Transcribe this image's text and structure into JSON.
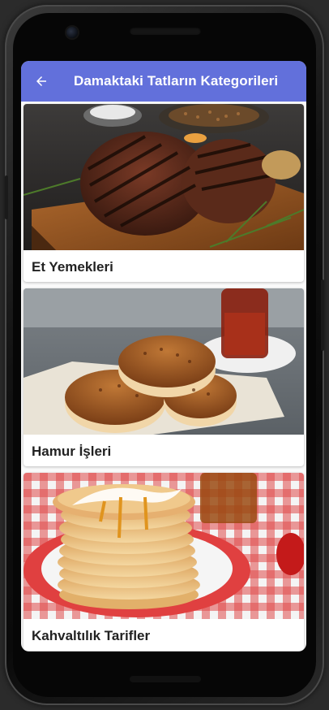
{
  "appbar": {
    "title": "Damaktaki Tatların Kategorileri",
    "back_icon": "arrow-left-icon",
    "background": "#6270db"
  },
  "categories": [
    {
      "title": "Et Yemekleri",
      "image": "grilled-steak-image"
    },
    {
      "title": "Hamur İşleri",
      "image": "pastry-buns-image"
    },
    {
      "title": "Kahvaltılık Tarifler",
      "image": "pancake-stack-image"
    }
  ]
}
